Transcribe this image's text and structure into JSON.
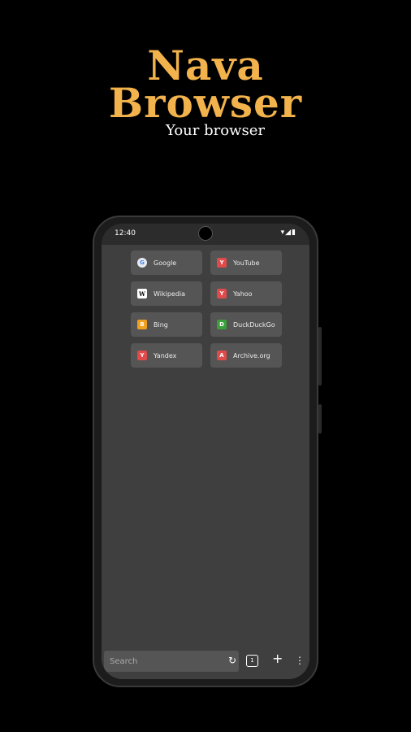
{
  "promo": {
    "title_line1": "Nava",
    "title_line2": "Browser",
    "subtitle": "Your browser"
  },
  "statusbar": {
    "time": "12:40",
    "icons": "▾◢▮"
  },
  "speed_dial": [
    {
      "label": "Google",
      "icon": "G",
      "color": "#e8eaed"
    },
    {
      "label": "YouTube",
      "icon": "Y",
      "color": "#e04a4a"
    },
    {
      "label": "Wikipedia",
      "icon": "W",
      "color": "#ffffff"
    },
    {
      "label": "Yahoo",
      "icon": "Y",
      "color": "#e04a4a"
    },
    {
      "label": "Bing",
      "icon": "B",
      "color": "#f0a020"
    },
    {
      "label": "DuckDuckGo",
      "icon": "D",
      "color": "#3aa03a"
    },
    {
      "label": "Yandex",
      "icon": "Y",
      "color": "#e04a4a"
    },
    {
      "label": "Archive.org",
      "icon": "A",
      "color": "#e04a4a"
    }
  ],
  "toolbar": {
    "search_placeholder": "Search",
    "reload_icon": "↻",
    "tab_count": "1",
    "add_icon": "+",
    "menu_icon": "⋮"
  }
}
